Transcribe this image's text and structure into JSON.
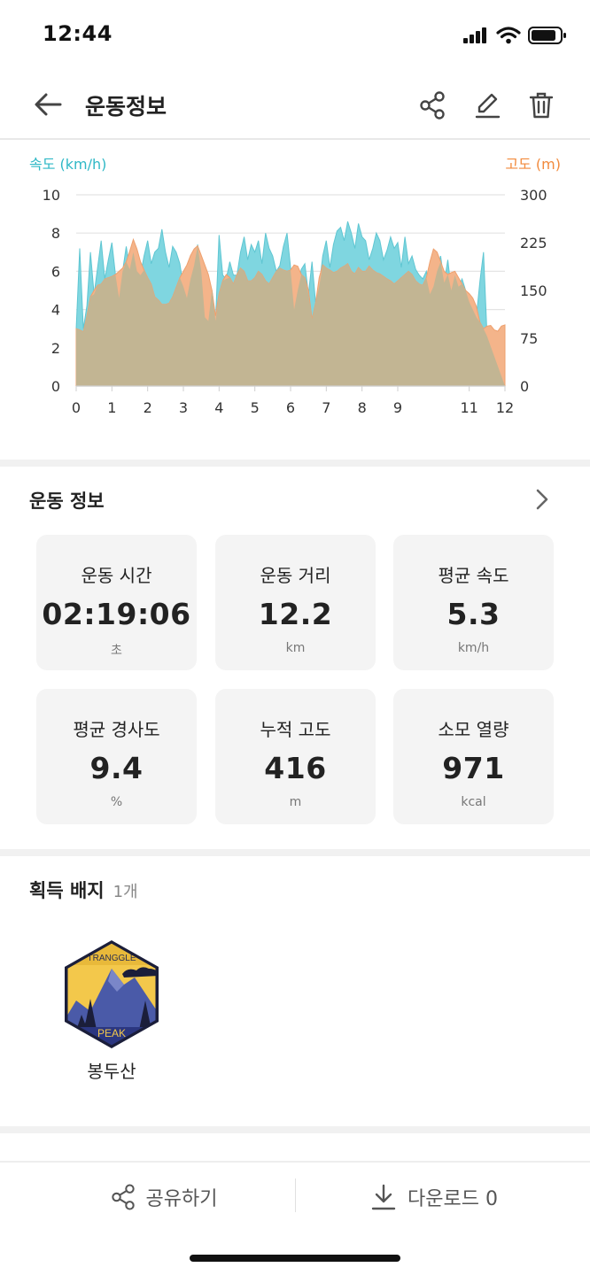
{
  "status_bar": {
    "time": "12:44"
  },
  "header": {
    "title": "운동정보"
  },
  "chart": {
    "legend_left": "속도 (km/h)",
    "legend_right": "고도 (m)",
    "left_ticks": [
      "0",
      "2",
      "4",
      "6",
      "8",
      "10"
    ],
    "right_ticks": [
      "0",
      "75",
      "150",
      "225",
      "300"
    ],
    "x_ticks": [
      "0",
      "1",
      "2",
      "3",
      "4",
      "5",
      "6",
      "7",
      "8",
      "9",
      "11",
      "12"
    ],
    "colors": {
      "speed": "#7fd6e0",
      "altitude": "#f4b48a",
      "overlap": "#c2b593"
    }
  },
  "chart_data": {
    "type": "area",
    "x": [
      0,
      0.1,
      0.2,
      0.3,
      0.4,
      0.5,
      0.6,
      0.7,
      0.8,
      0.9,
      1,
      1.1,
      1.2,
      1.3,
      1.4,
      1.5,
      1.6,
      1.7,
      1.8,
      1.9,
      2,
      2.1,
      2.2,
      2.3,
      2.4,
      2.5,
      2.6,
      2.7,
      2.8,
      2.9,
      3,
      3.1,
      3.2,
      3.3,
      3.4,
      3.5,
      3.6,
      3.7,
      3.8,
      3.9,
      4,
      4.1,
      4.2,
      4.3,
      4.4,
      4.5,
      4.6,
      4.7,
      4.8,
      4.9,
      5,
      5.1,
      5.2,
      5.3,
      5.4,
      5.5,
      5.6,
      5.7,
      5.8,
      5.9,
      6,
      6.1,
      6.2,
      6.3,
      6.4,
      6.5,
      6.6,
      6.7,
      6.8,
      6.9,
      7,
      7.1,
      7.2,
      7.3,
      7.4,
      7.5,
      7.6,
      7.7,
      7.8,
      7.9,
      8,
      8.1,
      8.2,
      8.3,
      8.4,
      8.5,
      8.6,
      8.7,
      8.8,
      8.9,
      9,
      9.1,
      9.2,
      9.3,
      9.4,
      9.5,
      9.6,
      9.7,
      9.8,
      9.9,
      10,
      10.1,
      10.2,
      10.3,
      10.4,
      10.5,
      10.6,
      10.7,
      10.8,
      10.9,
      11,
      11.1,
      11.2,
      11.3,
      11.4,
      11.5,
      11.6,
      11.7,
      11.8,
      11.9,
      12
    ],
    "series": [
      {
        "name": "속도 (km/h)",
        "axis": "left",
        "values": [
          3.0,
          7.2,
          3.0,
          4.2,
          7.0,
          4.8,
          6.2,
          7.6,
          5.6,
          6.6,
          7.5,
          5.8,
          4.6,
          6.0,
          7.3,
          6.1,
          7.0,
          6.0,
          5.8,
          6.8,
          7.6,
          6.4,
          7.0,
          7.2,
          8.2,
          7.0,
          6.2,
          7.3,
          7.0,
          6.4,
          5.2,
          4.6,
          5.6,
          6.3,
          7.4,
          6.0,
          3.6,
          3.4,
          5.0,
          3.4,
          7.9,
          5.8,
          5.6,
          6.5,
          5.8,
          5.8,
          7.0,
          7.8,
          6.6,
          7.4,
          7.0,
          7.6,
          6.4,
          8.0,
          7.2,
          6.8,
          6.0,
          6.3,
          7.3,
          8.0,
          6.2,
          4.0,
          5.0,
          6.1,
          6.4,
          4.8,
          6.5,
          4.4,
          5.2,
          6.8,
          7.6,
          6.2,
          7.4,
          8.1,
          8.3,
          7.6,
          8.6,
          8.0,
          7.2,
          8.5,
          7.8,
          7.6,
          6.6,
          7.2,
          8.0,
          7.6,
          6.6,
          7.1,
          7.8,
          7.2,
          7.5,
          6.2,
          7.8,
          6.4,
          6.8,
          6.1,
          5.8,
          5.6,
          6.0,
          4.8,
          5.2,
          6.0,
          6.8,
          5.4,
          6.6,
          5.0,
          5.8,
          5.2,
          5.6,
          5.0,
          4.4,
          4.0,
          3.6,
          5.5,
          7.0,
          2.6
        ]
      },
      {
        "name": "고도 (m)",
        "axis": "right",
        "values": [
          90,
          88,
          85,
          110,
          140,
          150,
          158,
          160,
          168,
          170,
          172,
          175,
          180,
          185,
          195,
          212,
          230,
          215,
          195,
          182,
          170,
          160,
          140,
          135,
          128,
          128,
          130,
          140,
          155,
          170,
          180,
          190,
          205,
          215,
          220,
          205,
          190,
          175,
          150,
          110,
          145,
          165,
          175,
          170,
          160,
          175,
          185,
          180,
          165,
          165,
          170,
          180,
          175,
          165,
          160,
          170,
          180,
          185,
          182,
          180,
          182,
          190,
          188,
          175,
          170,
          150,
          105,
          130,
          170,
          190,
          185,
          182,
          178,
          180,
          185,
          188,
          192,
          180,
          176,
          186,
          180,
          180,
          188,
          182,
          178,
          176,
          172,
          168,
          165,
          160,
          165,
          170,
          175,
          180,
          175,
          165,
          160,
          158,
          170,
          195,
          215,
          210,
          195,
          180,
          175,
          178,
          180,
          170,
          160,
          150,
          145,
          138,
          125,
          100,
          90,
          94,
          95,
          88,
          86,
          94,
          96
        ]
      }
    ],
    "xlim": [
      0,
      12
    ],
    "ylim_left": [
      0,
      10
    ],
    "ylim_right": [
      0,
      300
    ],
    "grid": true
  },
  "workout": {
    "title": "운동 정보",
    "stats": [
      {
        "label": "운동 시간",
        "value": "02:19:06",
        "unit": "초"
      },
      {
        "label": "운동 거리",
        "value": "12.2",
        "unit": "km"
      },
      {
        "label": "평균 속도",
        "value": "5.3",
        "unit": "km/h"
      },
      {
        "label": "평균 경사도",
        "value": "9.4",
        "unit": "%"
      },
      {
        "label": "누적 고도",
        "value": "416",
        "unit": "m"
      },
      {
        "label": "소모 열량",
        "value": "971",
        "unit": "kcal"
      }
    ]
  },
  "badges": {
    "title": "획득 배지",
    "count": "1개",
    "items": [
      {
        "name": "봉두산",
        "top_text": "TRANGGLE",
        "bottom_text": "PEAK"
      }
    ]
  },
  "bottom": {
    "share_label": "공유하기",
    "download_label": "다운로드 0"
  }
}
